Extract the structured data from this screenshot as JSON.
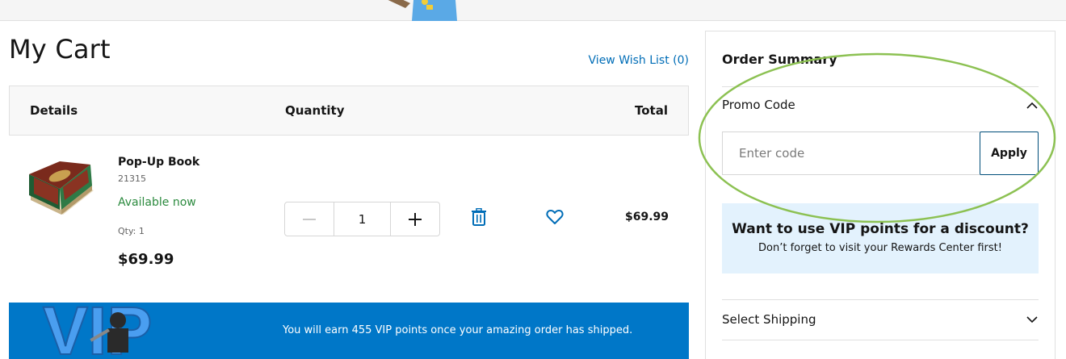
{
  "cart": {
    "title": "My Cart",
    "wishlist_link": "View Wish List (0)",
    "headers": {
      "details": "Details",
      "quantity": "Quantity",
      "total": "Total"
    },
    "items": [
      {
        "name": "Pop-Up Book",
        "sku": "21315",
        "availability": "Available now",
        "qty_label": "Qty: 1",
        "price": "$69.99",
        "quantity": "1",
        "line_total": "$69.99"
      }
    ]
  },
  "vip_banner": {
    "art_label": "VIP",
    "text": "You will earn 455 VIP points once your amazing order has shipped."
  },
  "summary": {
    "title": "Order Summary",
    "promo": {
      "label": "Promo Code",
      "placeholder": "Enter code",
      "apply_label": "Apply"
    },
    "vip_box": {
      "title": "Want to use VIP points for a discount?",
      "subtitle": "Don’t forget to visit your Rewards Center first!"
    },
    "shipping_label": "Select Shipping"
  },
  "colors": {
    "accent": "#006db7",
    "vip_banner": "#0077c8",
    "vip_box": "#e3f2fd",
    "available": "#2b8a3e",
    "highlight": "#8cc152"
  },
  "icons": [
    "minus-icon",
    "plus-icon",
    "trash-icon",
    "heart-icon",
    "chevron-up-icon",
    "chevron-down-icon"
  ]
}
